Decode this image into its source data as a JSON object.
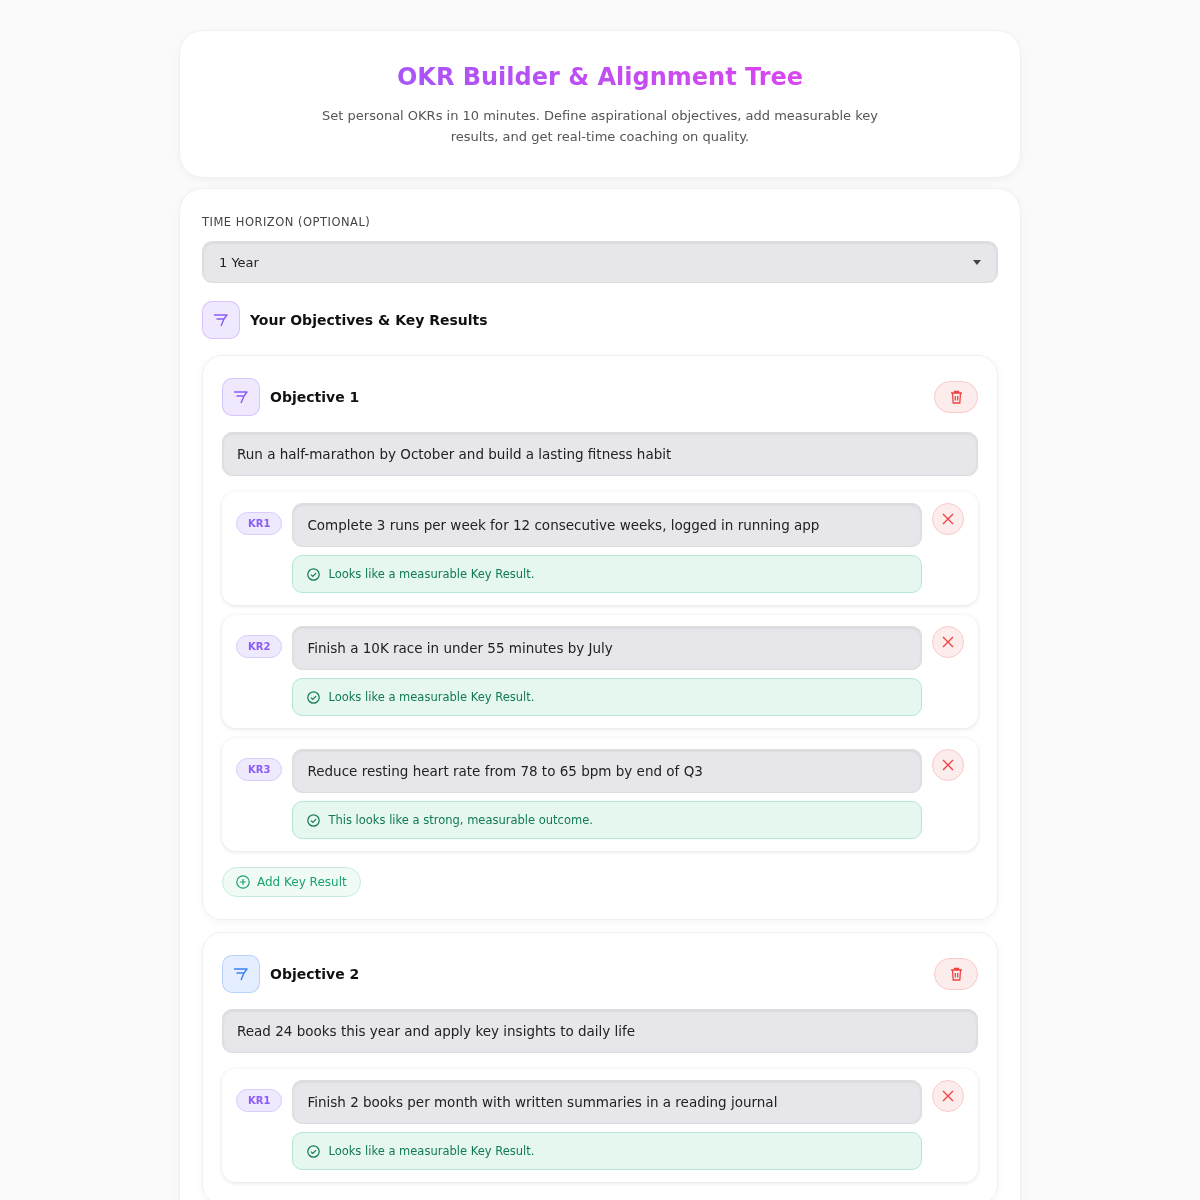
{
  "header": {
    "title": "OKR Builder & Alignment Tree",
    "subtitle": "Set personal OKRs in 10 minutes. Define aspirational objectives, add measurable key results, and get real-time coaching on quality."
  },
  "time_horizon": {
    "label": "TIME HORIZON (OPTIONAL)",
    "value": "1 Year"
  },
  "section_title": "Your Objectives & Key Results",
  "objectives": [
    {
      "title": "Objective 1",
      "color": "#8b5cf6",
      "value": "Run a half-marathon by October and build a lasting fitness habit",
      "key_results": [
        {
          "badge": "KR1",
          "value": "Complete 3 runs per week for 12 consecutive weeks, logged in running app",
          "feedback": {
            "kind": "ok",
            "text": "Looks like a measurable Key Result."
          }
        },
        {
          "badge": "KR2",
          "value": "Finish a 10K race in under 55 minutes by July",
          "feedback": {
            "kind": "ok",
            "text": "Looks like a measurable Key Result."
          }
        },
        {
          "badge": "KR3",
          "value": "Reduce resting heart rate from 78 to 65 bpm by end of Q3",
          "feedback": {
            "kind": "ok",
            "text": "This looks like a strong, measurable outcome."
          }
        }
      ],
      "add_label": "Add Key Result"
    },
    {
      "title": "Objective 2",
      "color": "#3b82f6",
      "value": "Read 24 books this year and apply key insights to daily life",
      "key_results": [
        {
          "badge": "KR1",
          "value": "Finish 2 books per month with written summaries in a reading journal",
          "feedback": {
            "kind": "ok",
            "text": "Looks like a measurable Key Result."
          }
        }
      ]
    }
  ]
}
